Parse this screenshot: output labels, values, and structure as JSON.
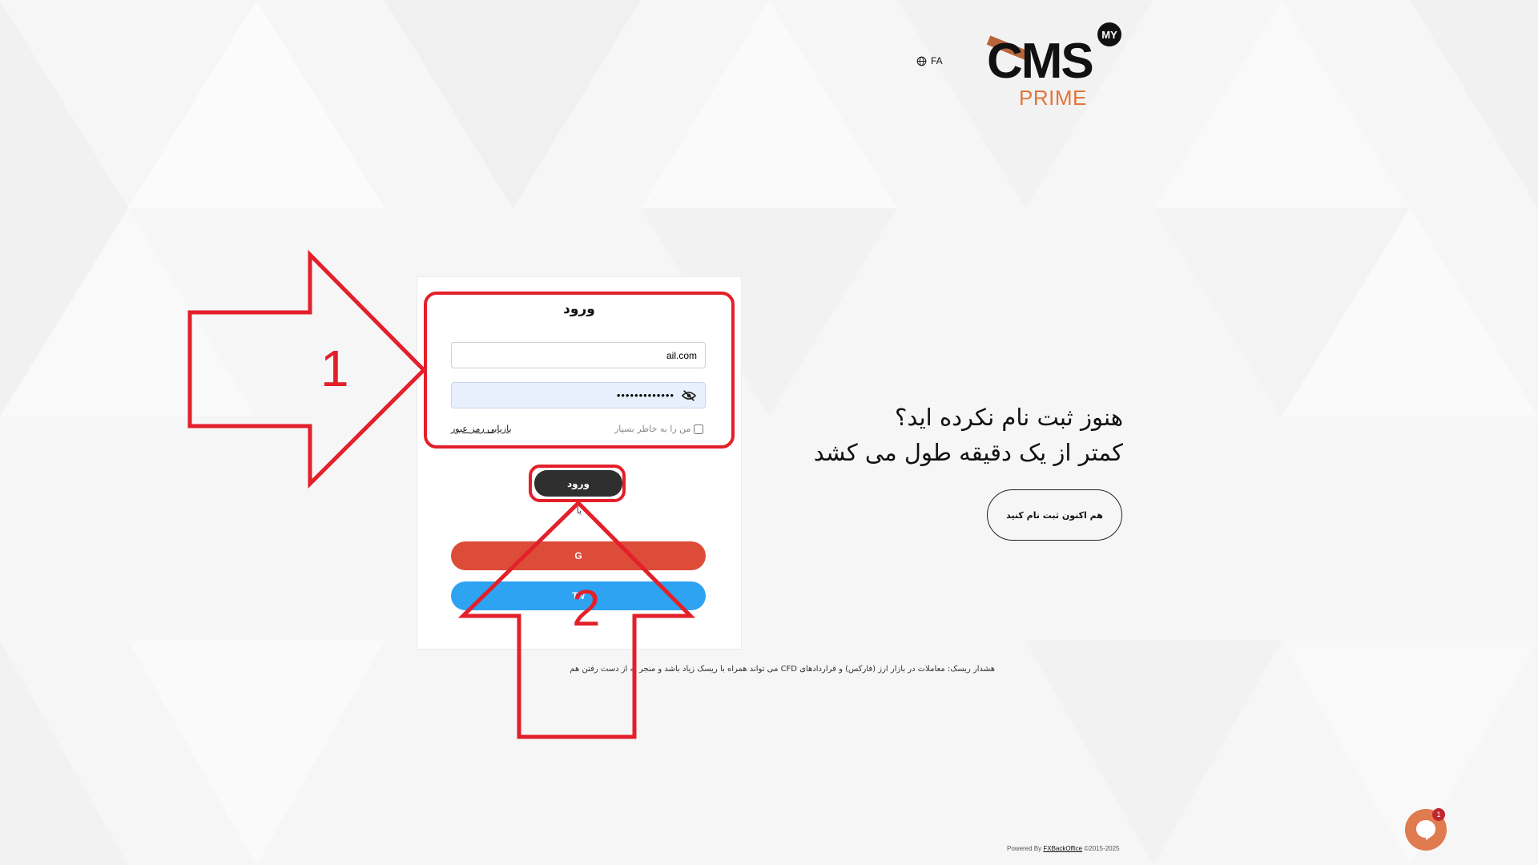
{
  "header": {
    "language": "FA",
    "logo": {
      "my": "MY",
      "cms": "CMS",
      "prime": "PRIME"
    }
  },
  "login": {
    "title": "ورود",
    "email_value": "ail.com",
    "password_value": "•••••••••••••",
    "remember_label": "من را به خاطر بسپار",
    "forgot_label": "بازیابی رمز عبور",
    "submit_label": "ورود",
    "or_label": "یا",
    "google_label": "G",
    "twitter_label": "Tw"
  },
  "signup": {
    "line1": "هنوز ثبت نام نکرده اید؟",
    "line2": "کمتر از یک دقیقه طول می کشد",
    "button_label": "هم اکنون ثبت نام کنید"
  },
  "risk_warning": "هشدار ریسک: معاملات در بازار ارز (فارکس) و قراردادهای CFD می تواند همراه با ریسک زیاد باشد و منجر به از دست رفتن هم",
  "footer": {
    "powered_by": "Powered By",
    "brand": "FXBackOffice",
    "copyright": "©2015-2025"
  },
  "chat": {
    "badge_count": "1"
  },
  "annotations": {
    "arrow1_label": "1",
    "arrow2_label": "2"
  },
  "colors": {
    "accent_orange": "#e0763a",
    "google_red": "#dd4b39",
    "twitter_blue": "#2da3f2",
    "dark_button": "#2f2f2f",
    "annotation_red": "#e3202a"
  }
}
